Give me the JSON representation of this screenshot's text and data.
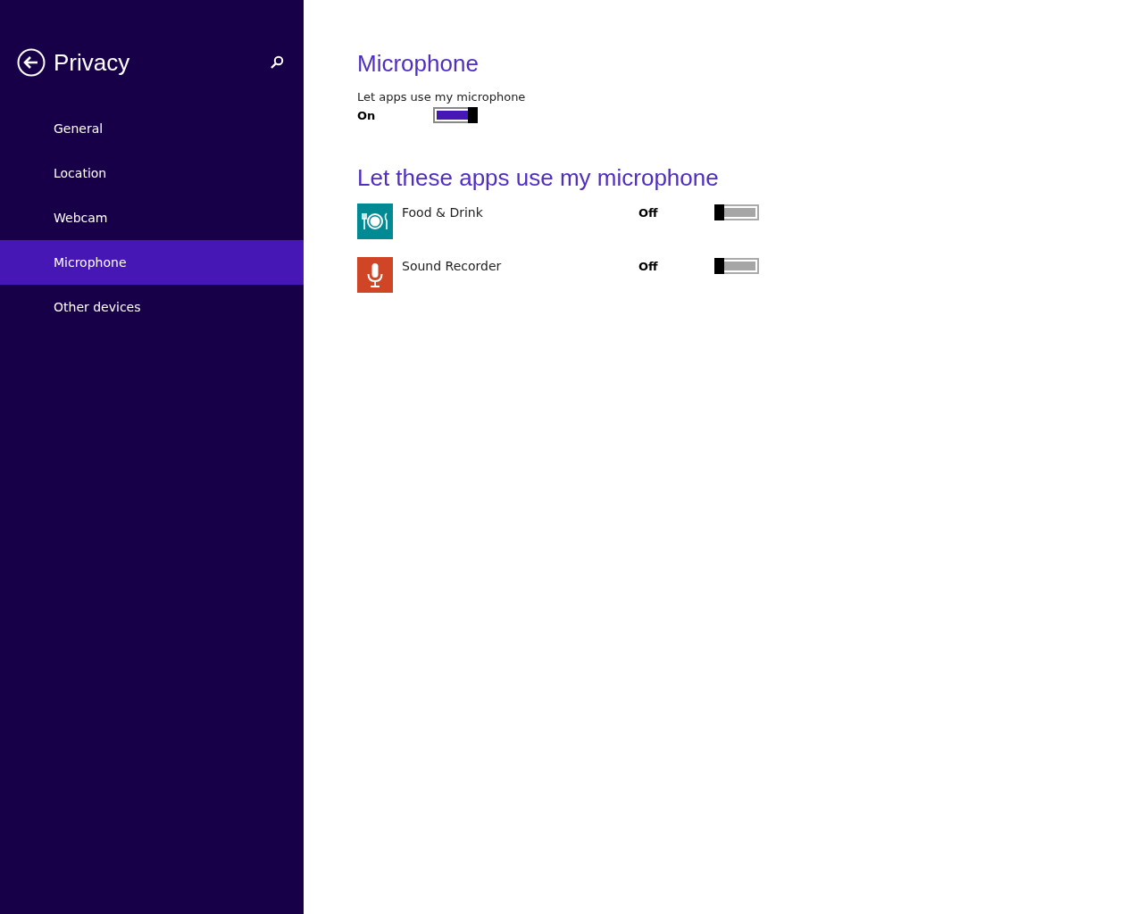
{
  "sidebar": {
    "title": "Privacy",
    "items": [
      {
        "label": "General",
        "selected": false
      },
      {
        "label": "Location",
        "selected": false
      },
      {
        "label": "Webcam",
        "selected": false
      },
      {
        "label": "Microphone",
        "selected": true
      },
      {
        "label": "Other devices",
        "selected": false
      }
    ]
  },
  "main": {
    "title": "Microphone",
    "setting_label": "Let apps use my microphone",
    "toggle": {
      "state_text": "On",
      "on": true
    },
    "apps_title": "Let these apps use my microphone",
    "apps": [
      {
        "name": "Food & Drink",
        "kind": "food",
        "color": "#008a94",
        "state_text": "Off",
        "on": false
      },
      {
        "name": "Sound Recorder",
        "kind": "recorder",
        "color": "#d04525",
        "state_text": "Off",
        "on": false
      }
    ]
  }
}
